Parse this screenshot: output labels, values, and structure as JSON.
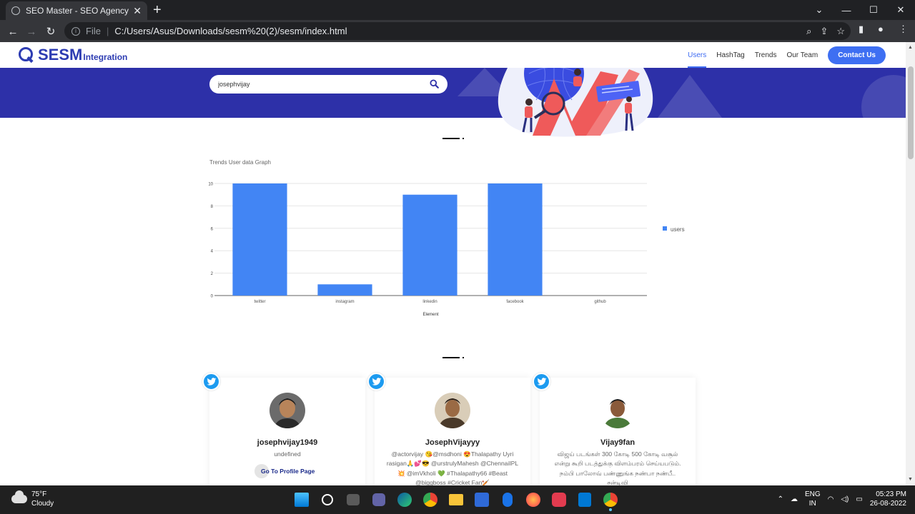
{
  "browser": {
    "tab_title": "SEO Master - SEO Agency Websi",
    "address_scheme": "File",
    "url": "C:/Users/Asus/Downloads/sesm%20(2)/sesm/index.html"
  },
  "site": {
    "brand": "SESM",
    "brand_sub": "Integration",
    "nav": {
      "users": "Users",
      "hashtag": "HashTag",
      "trends": "Trends",
      "our_team": "Our Team",
      "contact": "Contact Us"
    },
    "search": {
      "value": "josephvijay"
    }
  },
  "chart_title": "Trends User data Graph",
  "chart_data": {
    "type": "bar",
    "categories": [
      "twitter",
      "instagram",
      "linkedin",
      "facebook",
      "github"
    ],
    "series": [
      {
        "name": "users",
        "values": [
          10,
          1,
          9,
          10,
          0
        ],
        "color": "#4285f4"
      }
    ],
    "xlabel": "Element",
    "ylabel": "",
    "ylim": [
      0,
      10
    ],
    "yticks": [
      "0",
      "2",
      "4",
      "6",
      "8",
      "10"
    ],
    "grid": true,
    "legend": "right"
  },
  "cards": [
    {
      "username": "josephvijay1949",
      "bio": "undefined",
      "button": "Go To Profile Page"
    },
    {
      "username": "JosephVijayyy",
      "bio": "@actorvijay 😘@msdhoni 😍Thalapathy Uyri rasigan🙏💕😎 @urstrulyMahesh @ChennaiIPL💥 @imVkholi 💚 #Thalapathy66 #Beast @biggboss #Cricket Fan🏏"
    },
    {
      "username": "Vijay9fan",
      "bio": "விஜய் படங்கள் 300 கோடி 500 கோடி வசூல் என்று கூறி படத்துக்கு விளம்பரம் செய்யபடும். நம்பி பாலோவ் பண்ணுங்க நண்பா நண்பீ.. சன்டிவி"
    }
  ],
  "taskbar": {
    "temp": "75°F",
    "condition": "Cloudy",
    "lang1": "ENG",
    "lang2": "IN",
    "time": "05:23 PM",
    "date": "26-08-2022"
  },
  "colors": {
    "hero_bg": "#2d30a8",
    "brand": "#2d3cb2",
    "accent": "#3e6ff2",
    "bar": "#4285f4",
    "twitter": "#1d9bf0"
  }
}
